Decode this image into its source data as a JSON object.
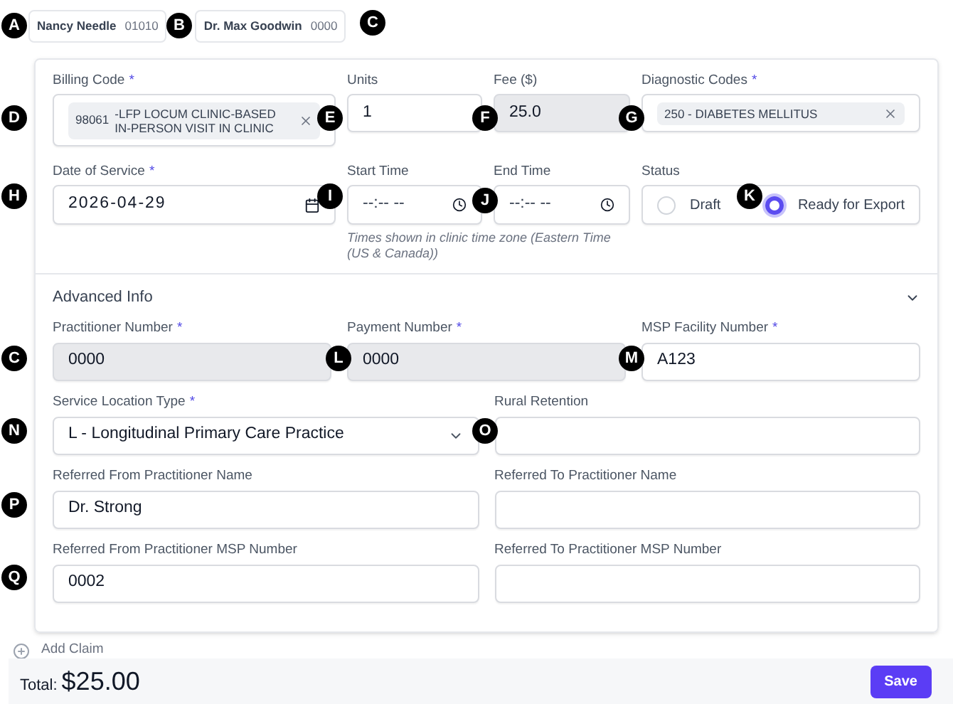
{
  "header_chips": [
    {
      "name": "Nancy Needle",
      "number": "01010"
    },
    {
      "name": "Dr. Max Goodwin",
      "number": "0000"
    }
  ],
  "main_rows": [
    [
      {
        "kind": "tag",
        "label": "Billing Code",
        "required_mark": "*",
        "code": "98061",
        "text": "-LFP LOCUM CLINIC-BASED IN-PERSON VISIT IN CLINIC"
      },
      {
        "kind": "text",
        "label": "Units",
        "value": "1",
        "disabled": false
      },
      {
        "kind": "text",
        "label": "Fee ($)",
        "value": "25.0",
        "disabled": true
      },
      {
        "kind": "tag",
        "label": "Diagnostic Codes",
        "required_mark": "*",
        "text": "250 - DIABETES MELLITUS"
      }
    ],
    [
      {
        "kind": "date",
        "label": "Date of Service",
        "required_mark": "*",
        "value": "2026-04-29"
      },
      {
        "kind": "time",
        "label": "Start Time",
        "placeholder": "--:-- --"
      },
      {
        "kind": "time",
        "label": "End Time",
        "placeholder": "--:-- --"
      },
      {
        "kind": "status",
        "label": "Status",
        "options": [
          {
            "label": "Draft",
            "selected": false
          },
          {
            "label": "Ready for Export",
            "selected": true
          }
        ]
      }
    ]
  ],
  "time_hint": "Times shown in clinic time zone (Eastern Time (US & Canada))",
  "advanced": {
    "title": "Advanced Info",
    "expanded": true,
    "rows": [
      [
        {
          "kind": "text",
          "label": "Practitioner Number",
          "required_mark": "*",
          "value": "0000",
          "disabled": true
        },
        {
          "kind": "text",
          "label": "Payment Number",
          "required_mark": "*",
          "value": "0000",
          "disabled": true
        },
        {
          "kind": "text",
          "label": "MSP Facility Number",
          "required_mark": "*",
          "value": "A123",
          "disabled": false
        }
      ],
      [
        {
          "kind": "select",
          "label": "Service Location Type",
          "required_mark": "*",
          "value": "L - Longitudinal Primary Care Practice"
        },
        {
          "kind": "text",
          "label": "Rural Retention",
          "disabled": false
        }
      ],
      [
        {
          "kind": "text",
          "label": "Referred From Practitioner Name",
          "value": "Dr. Strong",
          "disabled": false
        },
        {
          "kind": "text",
          "label": "Referred To Practitioner Name",
          "disabled": false
        }
      ],
      [
        {
          "kind": "text",
          "label": "Referred From Practitioner MSP Number",
          "value": "0002",
          "disabled": false
        },
        {
          "kind": "text",
          "label": "Referred To Practitioner MSP Number",
          "disabled": false
        }
      ]
    ]
  },
  "add_claim": "Add Claim",
  "footer": {
    "total_label": "Total:",
    "total": "$25.00",
    "save": "Save"
  },
  "markers": [
    {
      "letter": "A"
    },
    {
      "letter": "B"
    },
    {
      "letter": "C"
    },
    {
      "letter": "D"
    },
    {
      "letter": "E"
    },
    {
      "letter": "F"
    },
    {
      "letter": "G"
    },
    {
      "letter": "H"
    },
    {
      "letter": "I"
    },
    {
      "letter": "J"
    },
    {
      "letter": "K"
    },
    {
      "letter": "C"
    },
    {
      "letter": "L"
    },
    {
      "letter": "M"
    },
    {
      "letter": "N"
    },
    {
      "letter": "O"
    },
    {
      "letter": "P"
    },
    {
      "letter": "Q"
    }
  ]
}
